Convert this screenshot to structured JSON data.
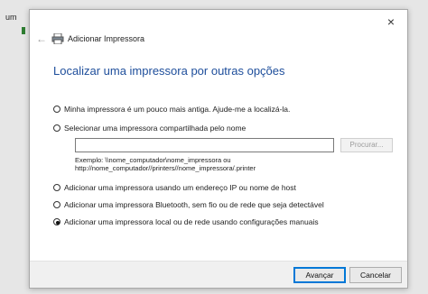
{
  "background": {
    "partial_text": "um"
  },
  "dialog": {
    "title": "Adicionar Impressora",
    "close_icon": "×",
    "back_icon": "←",
    "heading": "Localizar uma impressora por outras opções",
    "options": [
      {
        "label": "Minha impressora é um pouco mais antiga. Ajude-me a localizá-la.",
        "checked": false
      },
      {
        "label": "Selecionar uma impressora compartilhada pelo nome",
        "checked": false
      },
      {
        "label": "Adicionar uma impressora usando um endereço IP ou nome de host",
        "checked": false
      },
      {
        "label": "Adicionar uma impressora Bluetooth, sem fio ou de rede que seja detectável",
        "checked": false
      },
      {
        "label": "Adicionar uma impressora local ou de rede usando configurações manuais",
        "checked": true
      }
    ],
    "share_input": {
      "value": "",
      "placeholder": ""
    },
    "browse_label": "Procurar...",
    "example_line1": "Exemplo: \\\\nome_computador\\nome_impressora ou",
    "example_line2": "http://nome_computador//printers//nome_impressora/.printer",
    "buttons": {
      "next": "Avançar",
      "cancel": "Cancelar"
    }
  },
  "colors": {
    "heading": "#1e4e9b",
    "accent": "#0078d7"
  }
}
